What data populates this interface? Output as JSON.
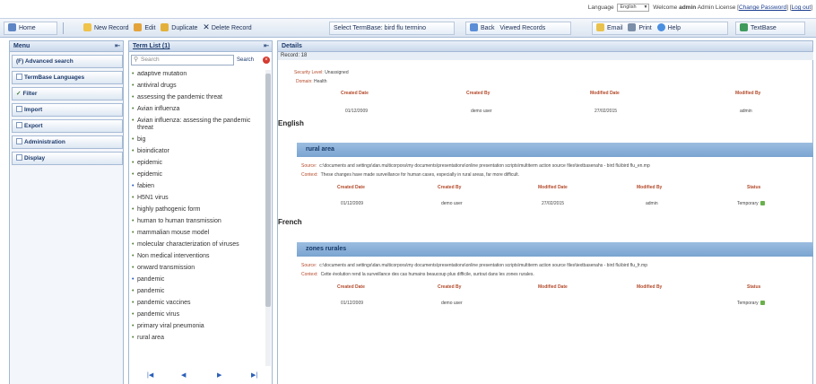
{
  "topbar": {
    "language_label": "Language",
    "language_value": "English",
    "welcome_prefix": "Welcome",
    "user": "admin",
    "license": "Admin License",
    "change_password": "Change Password",
    "logout": "Log out"
  },
  "toolbar": {
    "home": "Home",
    "new_record": "New Record",
    "edit": "Edit",
    "duplicate": "Duplicate",
    "delete": "Delete Record",
    "select_termbase": "Select TermBase: bird flu termino",
    "back": "Back",
    "viewed": "Viewed Records",
    "email": "Email",
    "print": "Print",
    "help": "Help",
    "textbase": "TextBase"
  },
  "menu": {
    "title": "Menu",
    "items": [
      {
        "label": "(F) Advanced search"
      },
      {
        "label": "TermBase Languages"
      },
      {
        "label": "Filter"
      },
      {
        "label": "Import"
      },
      {
        "label": "Export"
      },
      {
        "label": "Administration"
      },
      {
        "label": "Display"
      }
    ]
  },
  "term_list": {
    "title": "Term List (1)",
    "search_placeholder": "Search",
    "search_button": "Search",
    "terms": [
      "adaptive mutation",
      "antiviral drugs",
      "assessing the pandemic threat",
      "Avian influenza",
      "Avian influenza: assessing the pandemic threat",
      "big",
      "bioindicator",
      "epidemic",
      "epidemic",
      "fabien",
      "H5N1 virus",
      "highly pathogenic form",
      "human to human transmission",
      "mammalian mouse model",
      "molecular characterization of viruses",
      "Non medical interventions",
      "onward transmission",
      "pandemic",
      "pandemic",
      "pandemic vaccines",
      "pandemic virus",
      "primary viral pneumonia",
      "rural area"
    ],
    "pager": [
      "|◀",
      "◀",
      "▶",
      "▶|"
    ]
  },
  "details": {
    "title": "Details",
    "record": "Record: 18",
    "security_label": "Security Level:",
    "security_value": "Unassigned",
    "domain_label": "Domain:",
    "domain_value": "Health",
    "headers": [
      "Created Date",
      "Created By",
      "Modified Date",
      "Modified By"
    ],
    "values": [
      "01/12/2009",
      "demo user",
      "27/02/2015",
      "admin"
    ],
    "sections": [
      {
        "language": "English",
        "term": "rural area",
        "source_label": "Source:",
        "source": "c:\\documents and settings\\dan.multicorpora\\my documents\\presentations\\online presentation scripts\\multiterm action source files\\textbasenahs - bird flu\\bird flu_en.mp",
        "context_label": "Context:",
        "context": "These changes have made surveillance for human cases, especially in rural areas, far more difficult.",
        "headers": [
          "Created Date",
          "Created By",
          "Modified Date",
          "Modified By",
          "Status"
        ],
        "values": [
          "01/12/2009",
          "demo user",
          "27/02/2015",
          "admin",
          "Temporary"
        ]
      },
      {
        "language": "French",
        "term": "zones rurales",
        "source_label": "Source:",
        "source": "c:\\documents and settings\\dan.multicorpora\\my documents\\presentations\\online presentation scripts\\multiterm action source files\\textbasenahs - bird flu\\bird flu_fr.mp",
        "context_label": "Context:",
        "context": "Cette évolution rend la surveillance des cas humains beaucoup plus difficile, surtout dans les zones rurales.",
        "headers": [
          "Created Date",
          "Created By",
          "Modified Date",
          "Modified By",
          "Status"
        ],
        "values": [
          "01/12/2009",
          "demo user",
          "",
          "",
          "Temporary"
        ]
      }
    ]
  }
}
